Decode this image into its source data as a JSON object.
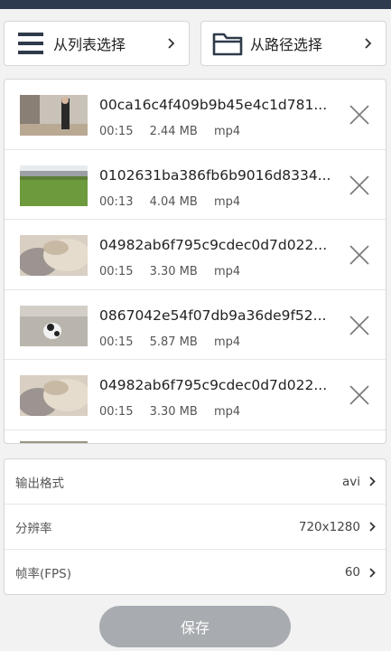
{
  "toolbar": {
    "from_list_label": "从列表选择",
    "from_path_label": "从路径选择"
  },
  "videos": [
    {
      "name": "00ca16c4f409b9b45e4c1d781...",
      "duration": "00:15",
      "size": "2.44 MB",
      "format": "mp4"
    },
    {
      "name": "0102631ba386fb6b9016d8334...",
      "duration": "00:13",
      "size": "4.04 MB",
      "format": "mp4"
    },
    {
      "name": "04982ab6f795c9cdec0d7d022...",
      "duration": "00:15",
      "size": "3.30 MB",
      "format": "mp4"
    },
    {
      "name": "0867042e54f07db9a36de9f52...",
      "duration": "00:15",
      "size": "5.87 MB",
      "format": "mp4"
    },
    {
      "name": "04982ab6f795c9cdec0d7d022...",
      "duration": "00:15",
      "size": "3.30 MB",
      "format": "mp4"
    }
  ],
  "settings": {
    "format": {
      "label": "输出格式",
      "value": "avi"
    },
    "resolution": {
      "label": "分辨率",
      "value": "720x1280"
    },
    "fps": {
      "label": "帧率(FPS)",
      "value": "60"
    }
  },
  "save_label": "保存",
  "colors": {
    "status_bar": "#2e3b4e",
    "save_button": "#a8acb0",
    "icon": "#2f3a4a"
  }
}
